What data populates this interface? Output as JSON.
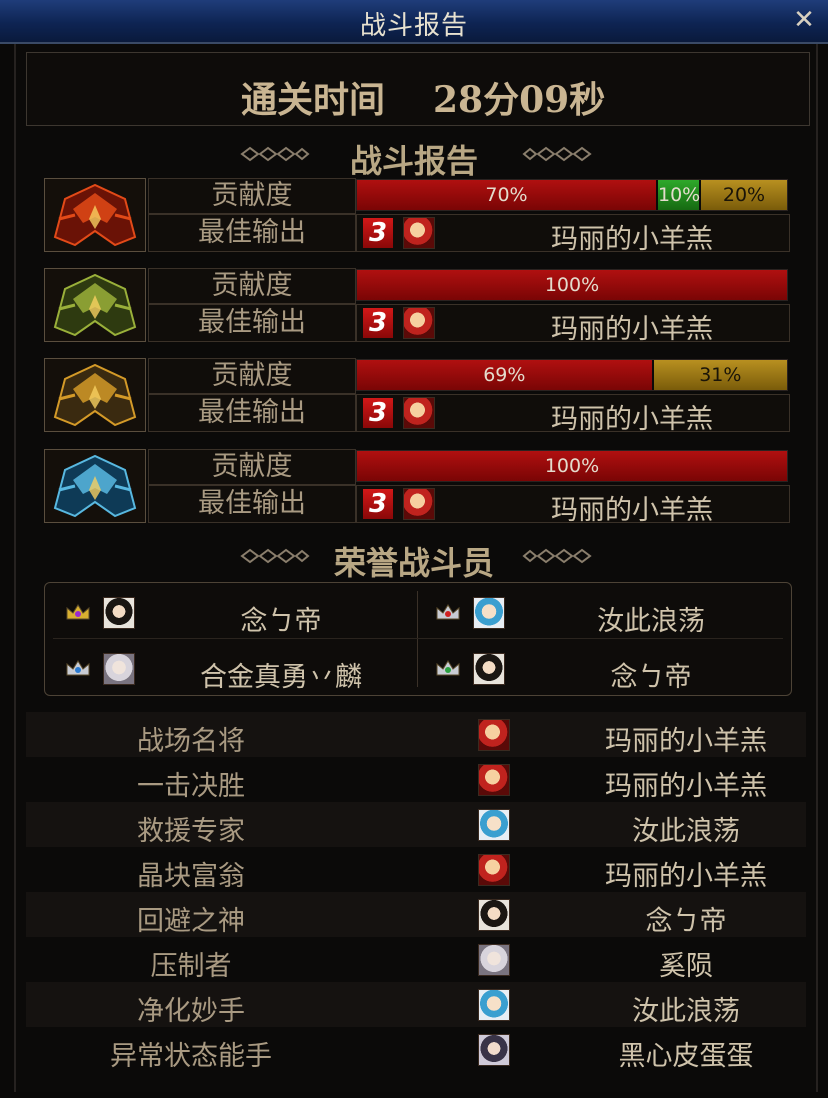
{
  "window": {
    "title": "战斗报告",
    "close": "✕"
  },
  "clear_time": {
    "label": "通关时间",
    "value": "28分09秒"
  },
  "report_section": {
    "title": "战斗报告"
  },
  "bosses": [
    {
      "icon": "flame-boss-icon",
      "contribution_label": "贡献度",
      "best_label": "最佳输出",
      "segments": [
        {
          "pct": 70,
          "color": "red",
          "label": "70%"
        },
        {
          "pct": 10,
          "color": "green",
          "label": "10%"
        },
        {
          "pct": 20,
          "color": "gold",
          "label": "20%"
        }
      ],
      "rank": "3",
      "player": "玛丽的小羊羔"
    },
    {
      "icon": "green-boss-icon",
      "contribution_label": "贡献度",
      "best_label": "最佳输出",
      "segments": [
        {
          "pct": 100,
          "color": "red",
          "label": "100%"
        }
      ],
      "rank": "3",
      "player": "玛丽的小羊羔"
    },
    {
      "icon": "gold-boss-icon",
      "contribution_label": "贡献度",
      "best_label": "最佳输出",
      "segments": [
        {
          "pct": 69,
          "color": "red",
          "label": "69%"
        },
        {
          "pct": 31,
          "color": "gold",
          "label": "31%"
        }
      ],
      "rank": "3",
      "player": "玛丽的小羊羔"
    },
    {
      "icon": "ice-boss-icon",
      "contribution_label": "贡献度",
      "best_label": "最佳输出",
      "segments": [
        {
          "pct": 100,
          "color": "red",
          "label": "100%"
        }
      ],
      "rank": "3",
      "player": "玛丽的小羊羔"
    }
  ],
  "honor_section": {
    "title": "荣誉战斗员"
  },
  "honor_players": [
    {
      "name": "念ㄅ帝",
      "crown": "gold-purple",
      "avatar": "dark"
    },
    {
      "name": "汝此浪荡",
      "crown": "silver-red",
      "avatar": "blue"
    },
    {
      "name": "合金真勇丷麟",
      "crown": "silver-blue",
      "avatar": "white"
    },
    {
      "name": "念ㄅ帝",
      "crown": "silver-green",
      "avatar": "dark"
    }
  ],
  "awards": [
    {
      "title": "战场名将",
      "player": "玛丽的小羊羔",
      "avatar": "red"
    },
    {
      "title": "一击决胜",
      "player": "玛丽的小羊羔",
      "avatar": "red"
    },
    {
      "title": "救援专家",
      "player": "汝此浪荡",
      "avatar": "blue"
    },
    {
      "title": "晶块富翁",
      "player": "玛丽的小羊羔",
      "avatar": "red"
    },
    {
      "title": "回避之神",
      "player": "念ㄅ帝",
      "avatar": "dark"
    },
    {
      "title": "压制者",
      "player": "奚陨",
      "avatar": "white"
    },
    {
      "title": "净化妙手",
      "player": "汝此浪荡",
      "avatar": "blue"
    },
    {
      "title": "异常状态能手",
      "player": "黑心皮蛋蛋",
      "avatar": "purple"
    }
  ],
  "colors": {
    "red": "#a30c0c",
    "green": "#2ea82a",
    "gold": "#b89020",
    "text": "#cfc3ab"
  }
}
